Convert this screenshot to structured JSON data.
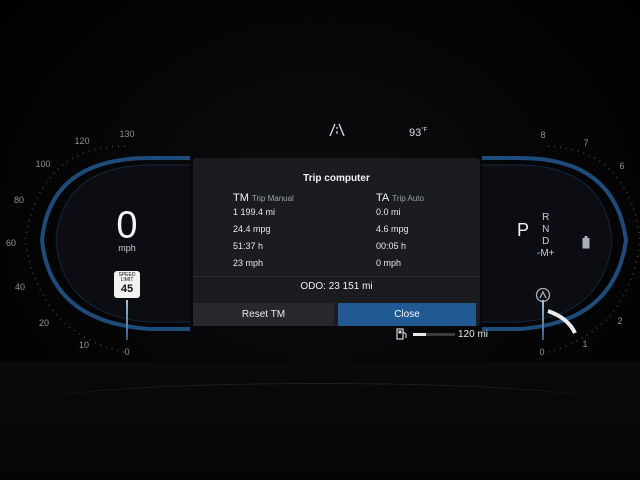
{
  "status": {
    "temperature": "93",
    "temperature_unit": "°F"
  },
  "speedometer": {
    "value": "0",
    "unit": "mph",
    "ticks": [
      "0",
      "10",
      "20",
      "40",
      "60",
      "80",
      "100",
      "120",
      "130"
    ],
    "speed_limit_label": "SPEED LIMIT",
    "speed_limit_value": "45"
  },
  "tachometer": {
    "ticks": [
      "0",
      "1",
      "2",
      "6",
      "7",
      "8"
    ]
  },
  "trip_computer": {
    "title": "Trip computer",
    "tm": {
      "label": "TM",
      "sub": "Trip Manual",
      "distance": "1 199.4 mi",
      "economy": "24.4 mpg",
      "time": "51:37 h",
      "avg_speed": "23 mph"
    },
    "ta": {
      "label": "TA",
      "sub": "Trip Auto",
      "distance": "0.0 mi",
      "economy": "4.6 mpg",
      "time": "00:05 h",
      "avg_speed": "0 mph"
    },
    "odo_label": "ODO:",
    "odo_value": "23 151 mi",
    "reset_label": "Reset TM",
    "close_label": "Close"
  },
  "gear": {
    "selected": "P",
    "others": [
      "R",
      "N",
      "D",
      "-M+"
    ]
  },
  "fuel": {
    "range": "120 mi",
    "level": 0.3
  },
  "icons": {
    "lane": "lane-assist-icon",
    "fuel": "fuel-pump-icon",
    "battery": "battery-icon",
    "eco": "eco-mode-icon"
  },
  "colors": {
    "accent": "#1f5a93",
    "gauge_arc": "#2e6aa8"
  }
}
